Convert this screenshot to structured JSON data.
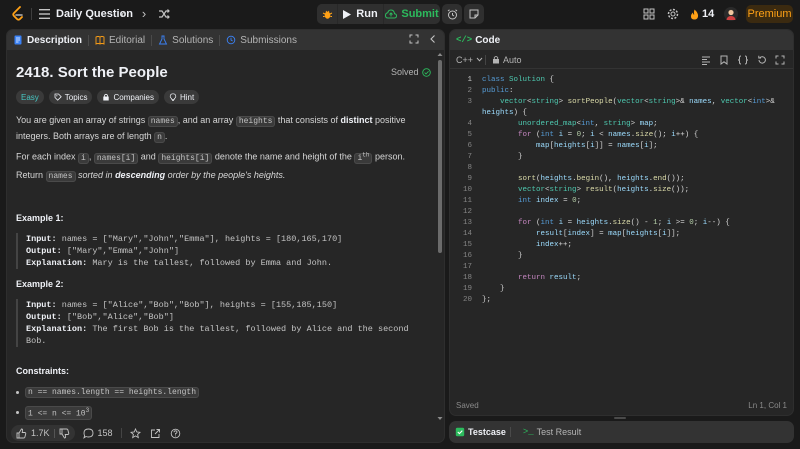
{
  "header": {
    "title": "Daily Question",
    "run_label": "Run",
    "submit_label": "Submit",
    "streak_count": "14",
    "premium_label": "Premium"
  },
  "left_tabs": [
    {
      "label": "Description"
    },
    {
      "label": "Editorial"
    },
    {
      "label": "Solutions"
    },
    {
      "label": "Submissions"
    }
  ],
  "problem": {
    "title": "2418. Sort the People",
    "status": "Solved",
    "tags": [
      "Easy",
      "Topics",
      "Companies",
      "Hint"
    ],
    "desc_1a": "You are given an array of strings ",
    "desc_1_code1": "names",
    "desc_1b": ", and an array ",
    "desc_1_code2": "heights",
    "desc_1c": " that consists of ",
    "desc_1_bold": "distinct",
    "desc_1d": " positive integers. Both arrays are of length ",
    "desc_1_code3": "n",
    "desc_1e": ".",
    "desc_2a": "For each index ",
    "desc_2_code1": "i",
    "desc_2b": ", ",
    "desc_2_code2": "names[i]",
    "desc_2c": " and ",
    "desc_2_code3": "heights[i]",
    "desc_2d": " denote the name and height of the ",
    "desc_2_code4": "i",
    "desc_2_sup": "th",
    "desc_2e": " person.",
    "desc_3a": "Return ",
    "desc_3_code": "names",
    "desc_3b": " sorted in ",
    "desc_3_bold": "descending",
    "desc_3c": " order by the people's heights.",
    "example1": {
      "title": "Example 1:",
      "input_label": "Input:",
      "input": "names = [\"Mary\",\"John\",\"Emma\"], heights = [180,165,170]",
      "output_label": "Output:",
      "output": "[\"Mary\",\"Emma\",\"John\"]",
      "expl_label": "Explanation:",
      "expl": "Mary is the tallest, followed by Emma and John."
    },
    "example2": {
      "title": "Example 2:",
      "input_label": "Input:",
      "input": "names = [\"Alice\",\"Bob\",\"Bob\"], heights = [155,185,150]",
      "output_label": "Output:",
      "output": "[\"Bob\",\"Alice\",\"Bob\"]",
      "expl_label": "Explanation:",
      "expl": "The first Bob is the tallest, followed by Alice and the second Bob."
    },
    "constraints_title": "Constraints:",
    "constraint1": "n == names.length == heights.length",
    "constraint2_base": "1 <= n <= 10",
    "constraint2_sup": "3"
  },
  "footer": {
    "likes": "1.7K",
    "comments": "158"
  },
  "editor": {
    "tab_label": "Code",
    "language": "C++",
    "mode": "Auto",
    "status_saved": "Saved",
    "cursor_pos": "Ln 1, Col 1"
  },
  "bottom": {
    "testcase_label": "Testcase",
    "test_result_label": "Test Result"
  }
}
